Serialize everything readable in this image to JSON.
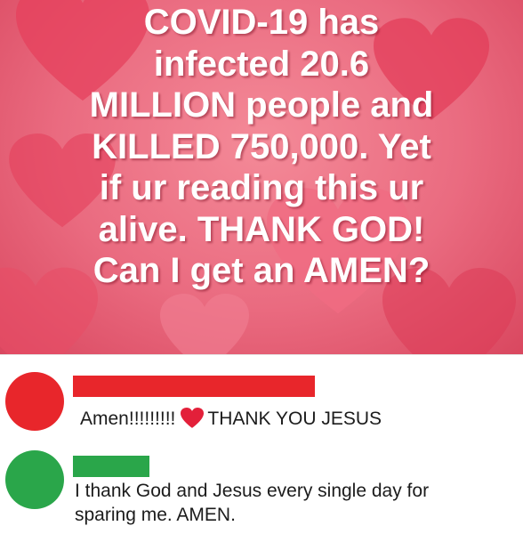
{
  "post": {
    "image_text": "COVID-19 has\ninfected 20.6\nMILLION people and\nKILLED 750,000. Yet\nif ur reading this ur\nalive. THANK GOD!\nCan I get an AMEN?",
    "background_color": "#ea6b80",
    "text_color": "#ffffff"
  },
  "comments": [
    {
      "avatar_color": "#e8262b",
      "name_bar_color": "#e8262b",
      "text_before_emoji": "Amen!!!!!!!!!",
      "emoji": "heart-emoji",
      "text_after_emoji": "THANK YOU JESUS"
    },
    {
      "avatar_color": "#2aa64a",
      "name_bar_color": "#2aa64a",
      "text": "I thank God and Jesus every single day for\nsparing me. AMEN."
    }
  ]
}
